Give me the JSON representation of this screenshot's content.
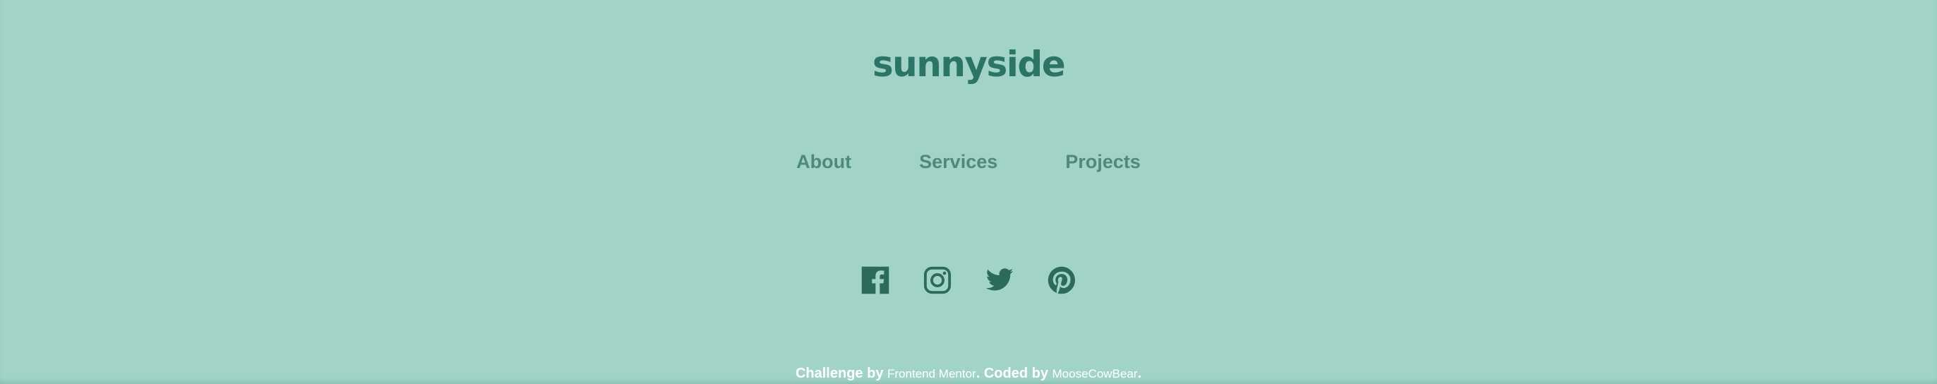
{
  "footer": {
    "logo": "sunnyside",
    "nav": [
      {
        "label": "About"
      },
      {
        "label": "Services"
      },
      {
        "label": "Projects"
      }
    ],
    "social": [
      {
        "icon": "facebook-icon"
      },
      {
        "icon": "instagram-icon"
      },
      {
        "icon": "twitter-icon"
      },
      {
        "icon": "pinterest-icon"
      }
    ],
    "attribution": {
      "challenge_prefix": "Challenge by",
      "challenge_link": "Frontend Mentor",
      "separator": ".",
      "coded_prefix": "Coded by",
      "coded_link": "MooseCowBear",
      "end": "."
    }
  },
  "colors": {
    "background": "#a1d4c7",
    "logo": "#2c7566",
    "nav_text": "#4d8a7c",
    "icon": "#2c6b5c",
    "attribution_text": "#ffffff"
  }
}
